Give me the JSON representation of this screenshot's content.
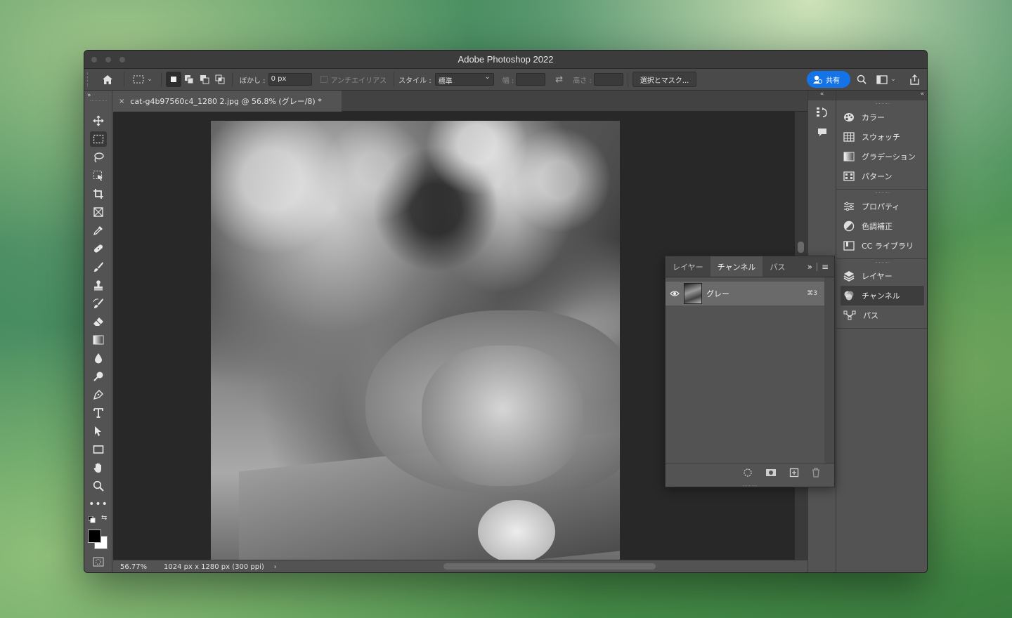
{
  "window": {
    "title": "Adobe Photoshop 2022"
  },
  "options_bar": {
    "feather_label": "ぼかし :",
    "feather_value": "0 px",
    "antialias_label": "アンチエイリアス",
    "style_label": "スタイル :",
    "style_value": "標準",
    "width_label": "幅 :",
    "height_label": "高さ :",
    "select_mask_label": "選択とマスク...",
    "share_label": "共有"
  },
  "document": {
    "tab_title": "cat-g4b97560c4_1280 2.jpg @ 56.8% (グレー/8) *",
    "zoom": "56.77%",
    "info": "1024 px x 1280 px (300 ppi)"
  },
  "channels_panel": {
    "tabs": [
      "レイヤー",
      "チャンネル",
      "パス"
    ],
    "active_tab": "チャンネル",
    "channel": {
      "name": "グレー",
      "shortcut": "⌘3"
    }
  },
  "dock": {
    "group1": [
      "カラー",
      "スウォッチ",
      "グラデーション",
      "パターン"
    ],
    "group2": [
      "プロパティ",
      "色調補正",
      "CC ライブラリ"
    ],
    "group3": [
      "レイヤー",
      "チャンネル",
      "パス"
    ],
    "active_item": "チャンネル"
  },
  "colors": {
    "accent": "#1473e6",
    "panel": "#535353",
    "canvas": "#282828"
  }
}
